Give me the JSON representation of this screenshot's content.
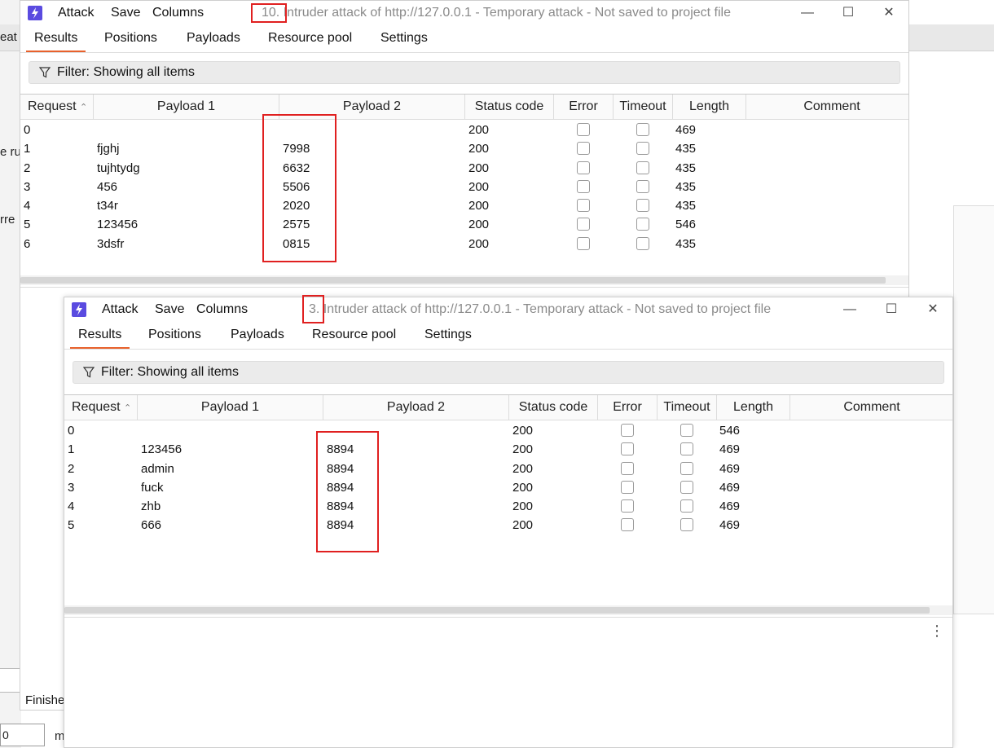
{
  "background": {
    "frag_eat": "eat",
    "frag_ru": "e ru",
    "frag_rre": "rre",
    "frag_finish": "Finishe",
    "frag_input": "0",
    "frag_m": "m"
  },
  "window_back": {
    "menu": {
      "attack": "Attack",
      "save": "Save",
      "columns": "Columns"
    },
    "title": "10. Intruder attack of http://127.0.0.1 - Temporary attack - Not saved to project file",
    "tabs": [
      "Results",
      "Positions",
      "Payloads",
      "Resource pool",
      "Settings"
    ],
    "filter": "Filter: Showing all items",
    "columns": [
      "Request",
      "Payload 1",
      "Payload 2",
      "Status code",
      "Error",
      "Timeout",
      "Length",
      "Comment"
    ],
    "rows": [
      {
        "request": "0",
        "payload1": "",
        "payload2": "",
        "status": "200",
        "length": "469"
      },
      {
        "request": "1",
        "payload1": "fjghj",
        "payload2": "7998",
        "status": "200",
        "length": "435"
      },
      {
        "request": "2",
        "payload1": "tujhtydg",
        "payload2": "6632",
        "status": "200",
        "length": "435"
      },
      {
        "request": "3",
        "payload1": "456",
        "payload2": "5506",
        "status": "200",
        "length": "435"
      },
      {
        "request": "4",
        "payload1": "t34r",
        "payload2": "2020",
        "status": "200",
        "length": "435"
      },
      {
        "request": "5",
        "payload1": "123456",
        "payload2": "2575",
        "status": "200",
        "length": "546"
      },
      {
        "request": "6",
        "payload1": "3dsfr",
        "payload2": "0815",
        "status": "200",
        "length": "435"
      }
    ]
  },
  "window_front": {
    "menu": {
      "attack": "Attack",
      "save": "Save",
      "columns": "Columns"
    },
    "title": "3. Intruder attack of http://127.0.0.1 - Temporary attack - Not saved to project file",
    "tabs": [
      "Results",
      "Positions",
      "Payloads",
      "Resource pool",
      "Settings"
    ],
    "filter": "Filter: Showing all items",
    "columns": [
      "Request",
      "Payload 1",
      "Payload 2",
      "Status code",
      "Error",
      "Timeout",
      "Length",
      "Comment"
    ],
    "rows": [
      {
        "request": "0",
        "payload1": "",
        "payload2": "",
        "status": "200",
        "length": "546"
      },
      {
        "request": "1",
        "payload1": "123456",
        "payload2": "8894",
        "status": "200",
        "length": "469"
      },
      {
        "request": "2",
        "payload1": "admin",
        "payload2": "8894",
        "status": "200",
        "length": "469"
      },
      {
        "request": "3",
        "payload1": "fuck",
        "payload2": "8894",
        "status": "200",
        "length": "469"
      },
      {
        "request": "4",
        "payload1": "zhb",
        "payload2": "8894",
        "status": "200",
        "length": "469"
      },
      {
        "request": "5",
        "payload1": "666",
        "payload2": "8894",
        "status": "200",
        "length": "469"
      }
    ]
  },
  "colors": {
    "accent_tab": "#e8612c",
    "highlight_box": "#e02020",
    "app_icon": "#5a4be0"
  }
}
